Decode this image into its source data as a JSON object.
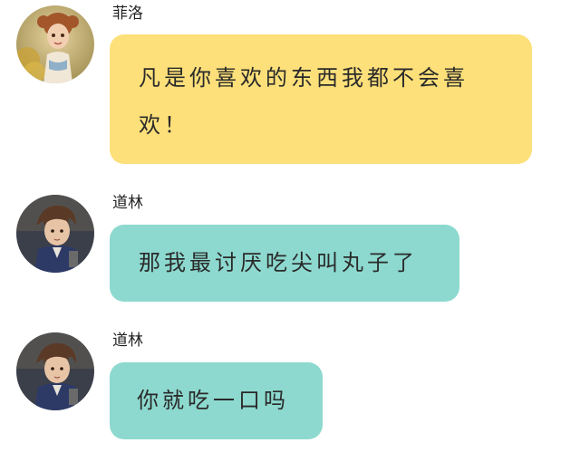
{
  "chat": {
    "messages": [
      {
        "sender": "菲洛",
        "text": "凡是你喜欢的东西我都不会喜欢！",
        "bubble_color": "#fde07a",
        "avatar_icon": "girl-avatar"
      },
      {
        "sender": "道林",
        "text": "那我最讨厌吃尖叫丸子了",
        "bubble_color": "#8dd9cf",
        "avatar_icon": "boy-avatar"
      },
      {
        "sender": "道林",
        "text": "你就吃一口吗",
        "bubble_color": "#8dd9cf",
        "avatar_icon": "boy-avatar"
      }
    ]
  }
}
